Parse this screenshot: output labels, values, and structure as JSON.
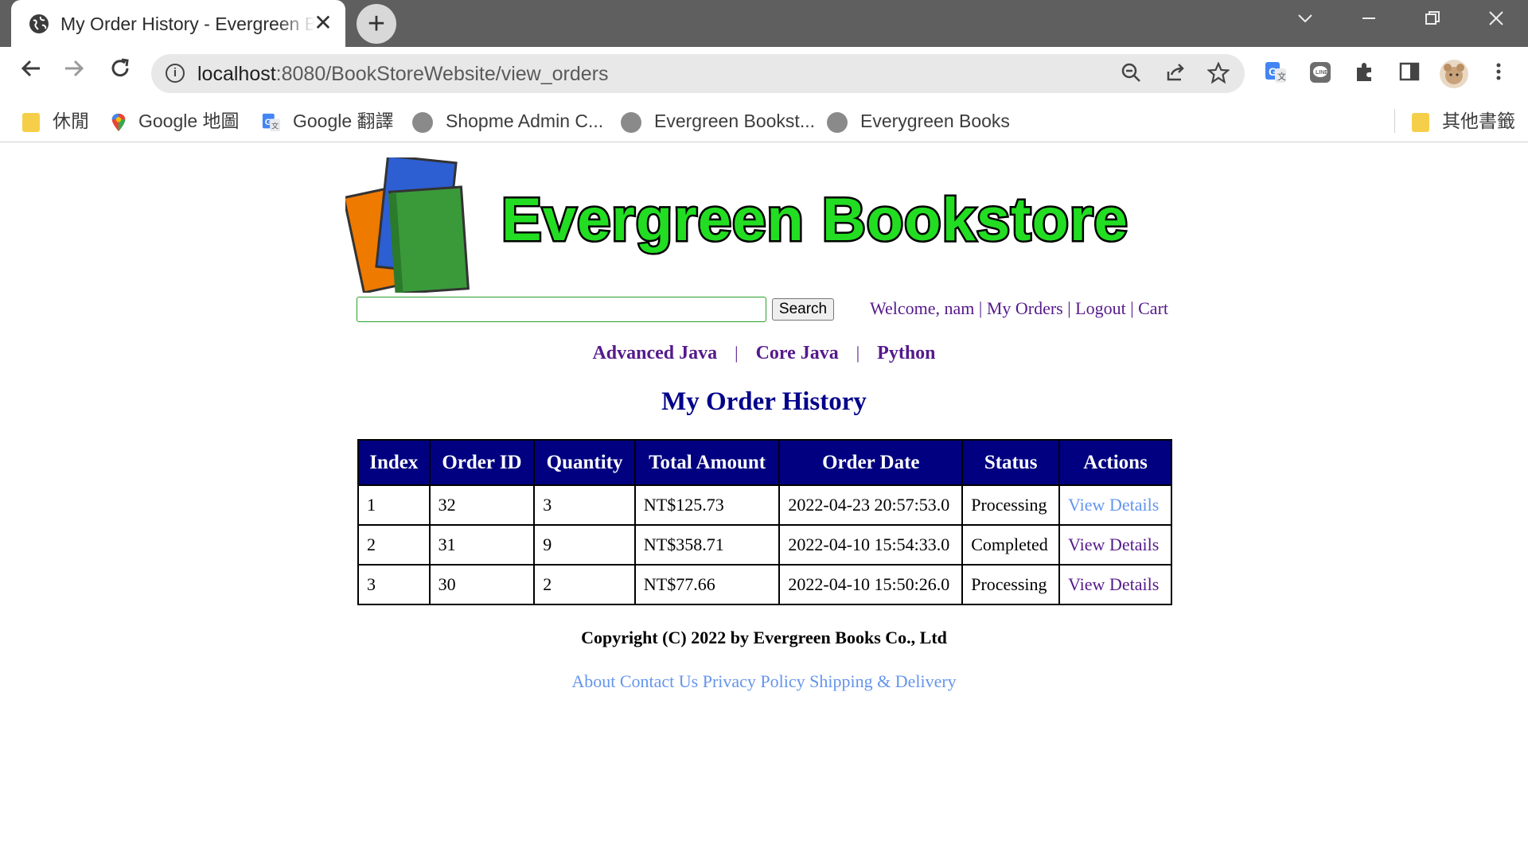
{
  "browser": {
    "tab_title": "My Order History - Evergreen Bookstore",
    "new_tab_symbol": "+",
    "close_symbol": "✕",
    "url_host": "localhost",
    "url_path": ":8080/BookStoreWebsite/view_orders",
    "bookmarks": [
      "休閒",
      "Google 地圖",
      "Google 翻譯",
      "Shopme Admin C...",
      "Evergreen Bookst...",
      "Everygreen Books"
    ],
    "other_bookmarks": "其他書籤"
  },
  "site": {
    "logo_text": "Evergreen Bookstore",
    "search_button": "Search",
    "user": {
      "welcome": "Welcome, nam",
      "my_orders": "My Orders",
      "logout": "Logout",
      "cart": "Cart",
      "separator": "|"
    },
    "categories": [
      "Advanced Java",
      "Core Java",
      "Python"
    ],
    "category_separator": "|"
  },
  "page": {
    "heading": "My Order History"
  },
  "orders_table": {
    "headers": [
      "Index",
      "Order ID",
      "Quantity",
      "Total Amount",
      "Order Date",
      "Status",
      "Actions"
    ],
    "rows": [
      {
        "index": "1",
        "order_id": "32",
        "quantity": "3",
        "total": "NT$125.73",
        "date": "2022-04-23 20:57:53.0",
        "status": "Processing",
        "action": "View Details"
      },
      {
        "index": "2",
        "order_id": "31",
        "quantity": "9",
        "total": "NT$358.71",
        "date": "2022-04-10 15:54:33.0",
        "status": "Completed",
        "action": "View Details"
      },
      {
        "index": "3",
        "order_id": "30",
        "quantity": "2",
        "total": "NT$77.66",
        "date": "2022-04-10 15:50:26.0",
        "status": "Processing",
        "action": "View Details"
      }
    ]
  },
  "footer": {
    "copyright": "Copyright (C) 2022 by Evergreen Books Co., Ltd",
    "links": [
      "About",
      "Contact Us",
      "Privacy Policy",
      "Shipping & Delivery"
    ]
  },
  "colors": {
    "table_header_bg": "#000080",
    "heading": "#00008b",
    "link_visited": "#551a8b",
    "link_light": "#6495ed",
    "logo_green": "#22dd22"
  }
}
